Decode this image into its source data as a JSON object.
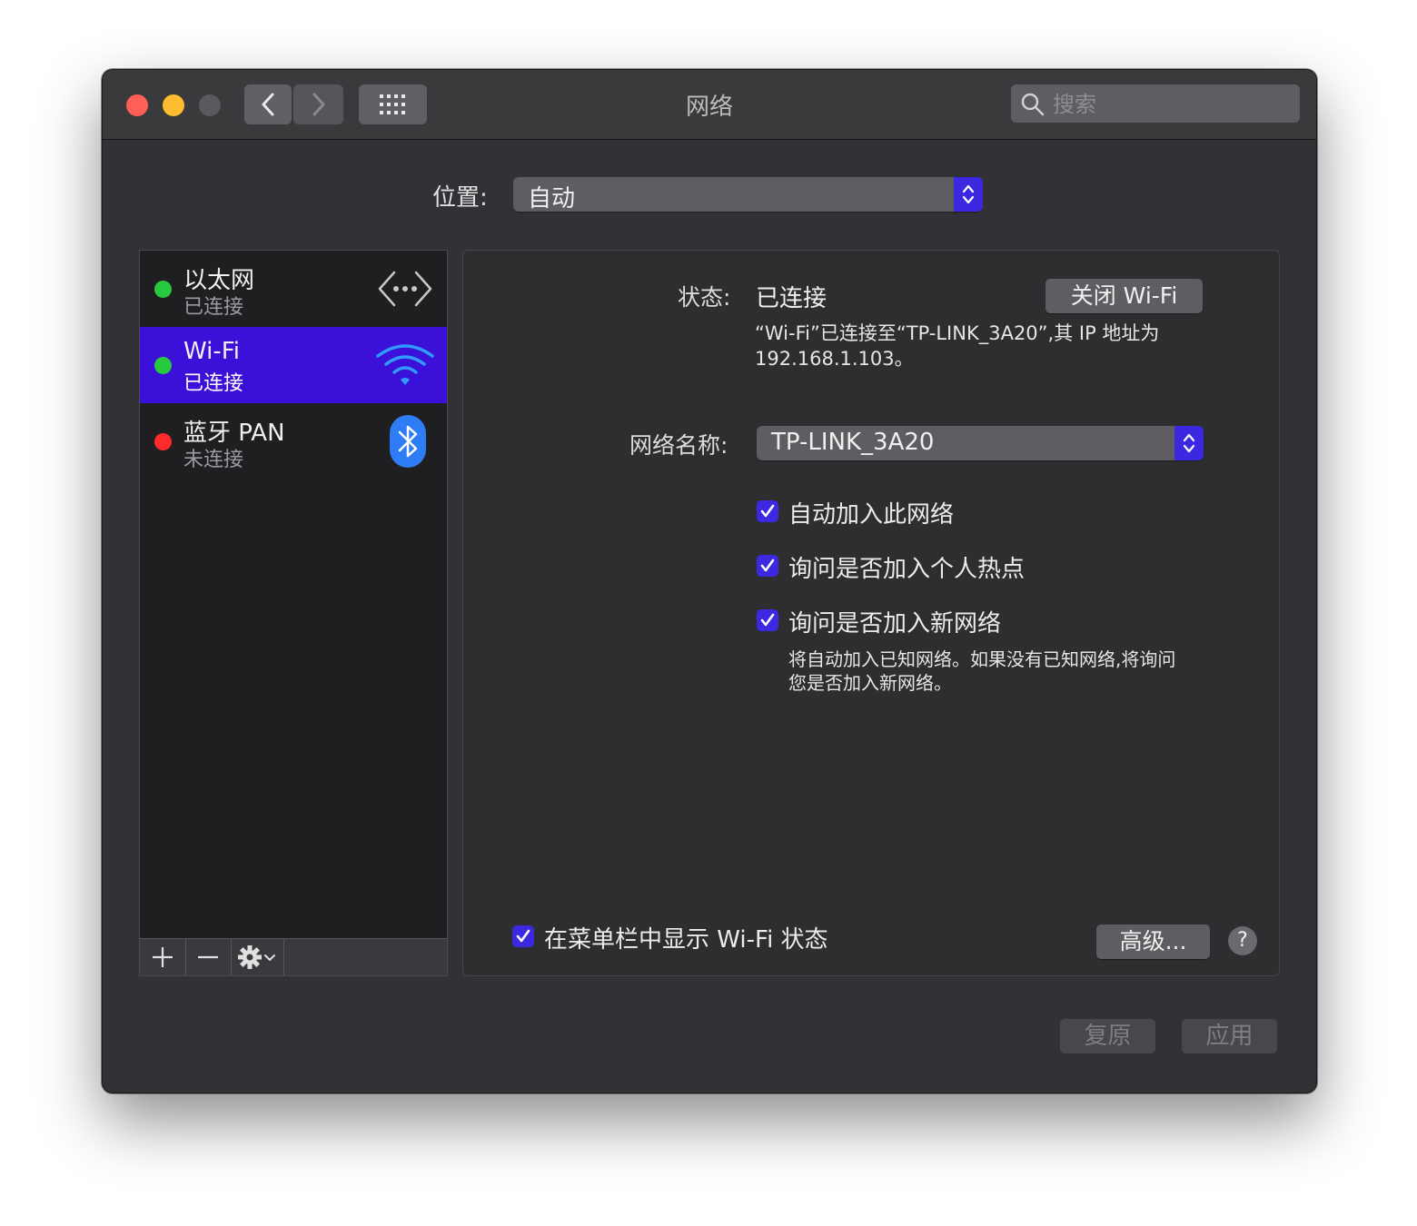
{
  "window": {
    "title": "网络"
  },
  "toolbar": {
    "search_placeholder": "搜索"
  },
  "location": {
    "label": "位置:",
    "value": "自动"
  },
  "services": [
    {
      "name": "以太网",
      "status": "已连接",
      "status_color": "#27c93f",
      "icon": "ethernet-icon",
      "selected": false
    },
    {
      "name": "Wi-Fi",
      "status": "已连接",
      "status_color": "#27c93f",
      "icon": "wifi-icon",
      "selected": true
    },
    {
      "name": "蓝牙 PAN",
      "status": "未连接",
      "status_color": "#ff2a2a",
      "icon": "bluetooth-icon",
      "selected": false
    }
  ],
  "detail": {
    "status_label": "状态:",
    "status_value": "已连接",
    "turn_off_button": "关闭 Wi-Fi",
    "status_description_line1": "“Wi-Fi”已连接至“TP-LINK_3A20”,其 IP 地址为",
    "status_description_line2": "192.168.1.103。",
    "network_name_label": "网络名称:",
    "network_name_value": "TP-LINK_3A20",
    "checkboxes": [
      {
        "label": "自动加入此网络",
        "checked": true
      },
      {
        "label": "询问是否加入个人热点",
        "checked": true
      },
      {
        "label": "询问是否加入新网络",
        "checked": true
      }
    ],
    "ask_new_description_line1": "将自动加入已知网络。如果没有已知网络,将询问",
    "ask_new_description_line2": "您是否加入新网络。",
    "show_in_menubar": {
      "label": "在菜单栏中显示 Wi-Fi 状态",
      "checked": true
    },
    "advanced_button": "高级...",
    "help_button": "?"
  },
  "footer": {
    "revert_button": "复原",
    "apply_button": "应用"
  },
  "colors": {
    "accent": "#3b28e0",
    "selection": "#3b10d8",
    "window_bg": "#323236"
  }
}
